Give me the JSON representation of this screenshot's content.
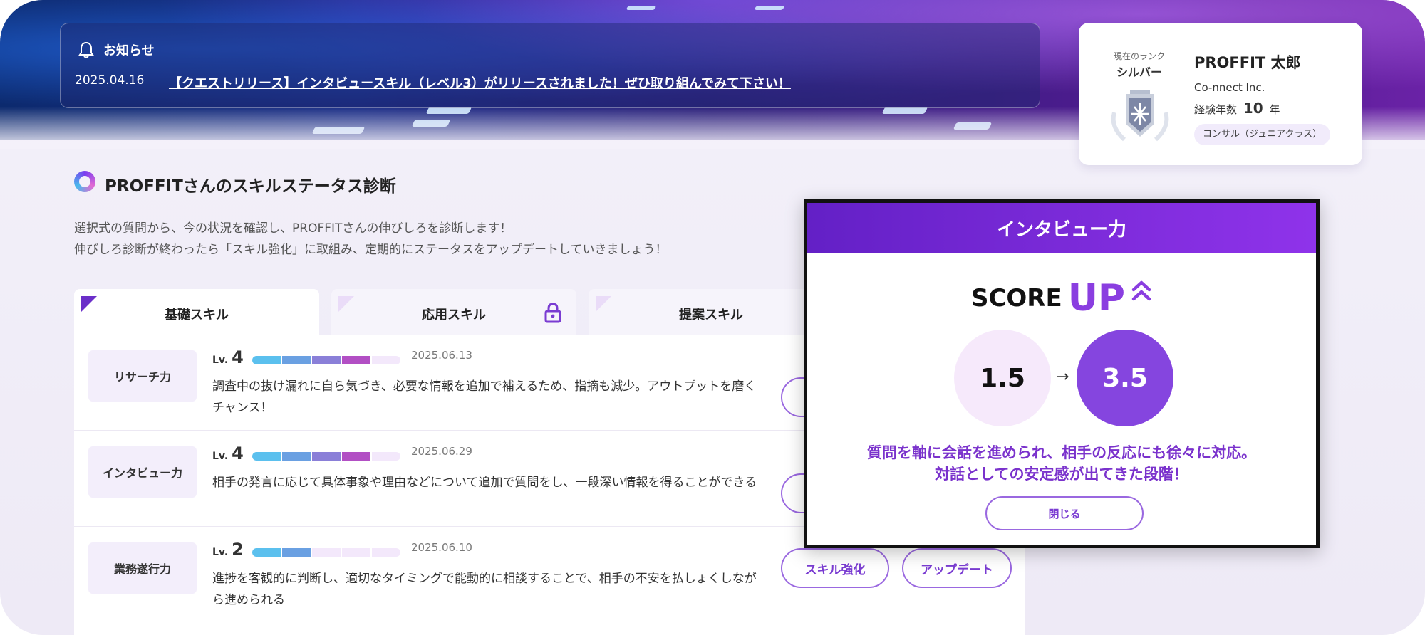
{
  "notice": {
    "title": "お知らせ",
    "date": "2025.04.16",
    "message": "【クエストリリース】インタビュースキル（レベル3）がリリースされました！ぜひ取り組んでみて下さい！"
  },
  "profile": {
    "rank_caption": "現在のランク",
    "rank_name": "シルバー",
    "name": "PROFFIT 太郎",
    "company": "Co-nnect Inc.",
    "experience_label": "経験年数",
    "experience_years": "10",
    "experience_unit": "年",
    "role_tag": "コンサル（ジュニアクラス）"
  },
  "section": {
    "title": "PROFFITさんのスキルステータス診断",
    "desc_line1": "選択式の質問から、今の状況を確認し、PROFFITさんの伸びしろを診断します！",
    "desc_line2": "伸びしろ診断が終わったら「スキル強化」に取組み、定期的にステータスをアップデートしていきましょう！"
  },
  "tabs": [
    {
      "label": "基礎スキル",
      "active": true
    },
    {
      "label": "応用スキル",
      "active": false,
      "locked": true
    },
    {
      "label": "提案スキル",
      "active": false
    }
  ],
  "skills": [
    {
      "name": "リサーチ力",
      "level_prefix": "Lv.",
      "level": "4",
      "filled_segments": 4,
      "total_segments": 5,
      "date": "2025.06.13",
      "description": "調査中の抜け漏れに自ら気づき、必要な情報を追加で補えるため、指摘も減少。アウトプットを磨くチャンス！"
    },
    {
      "name": "インタビュー力",
      "level_prefix": "Lv.",
      "level": "4",
      "filled_segments": 4,
      "total_segments": 5,
      "date": "2025.06.29",
      "description": "相手の発言に応じて具体事象や理由などについて追加で質問をし、一段深い情報を得ることができる"
    },
    {
      "name": "業務遂行力",
      "level_prefix": "Lv.",
      "level": "2",
      "filled_segments": 2,
      "total_segments": 5,
      "date": "2025.06.10",
      "description": "進捗を客観的に判断し、適切なタイミングで能動的に相談することで、相手の不安を払しょくしながら進められる"
    }
  ],
  "actions": {
    "strengthen_label": "スキル強化",
    "update_label": "アップデート"
  },
  "modal": {
    "title": "インタビュー力",
    "score_label": "SCORE",
    "up_label": "UP",
    "score_before": "1.5",
    "arrow": "→",
    "score_after": "3.5",
    "message_line1": "質問を軸に会話を進められ、相手の反応にも徐々に対応。",
    "message_line2": "対話としての安定感が出てきた段階！",
    "close_label": "閉じる"
  },
  "colors": {
    "accent_purple": "#8545df",
    "bar_segment_colors": [
      "#5bc0ee",
      "#6aa0e2",
      "#8a7fd8",
      "#b24fc4"
    ],
    "bar_empty": "#f3e8fb"
  }
}
